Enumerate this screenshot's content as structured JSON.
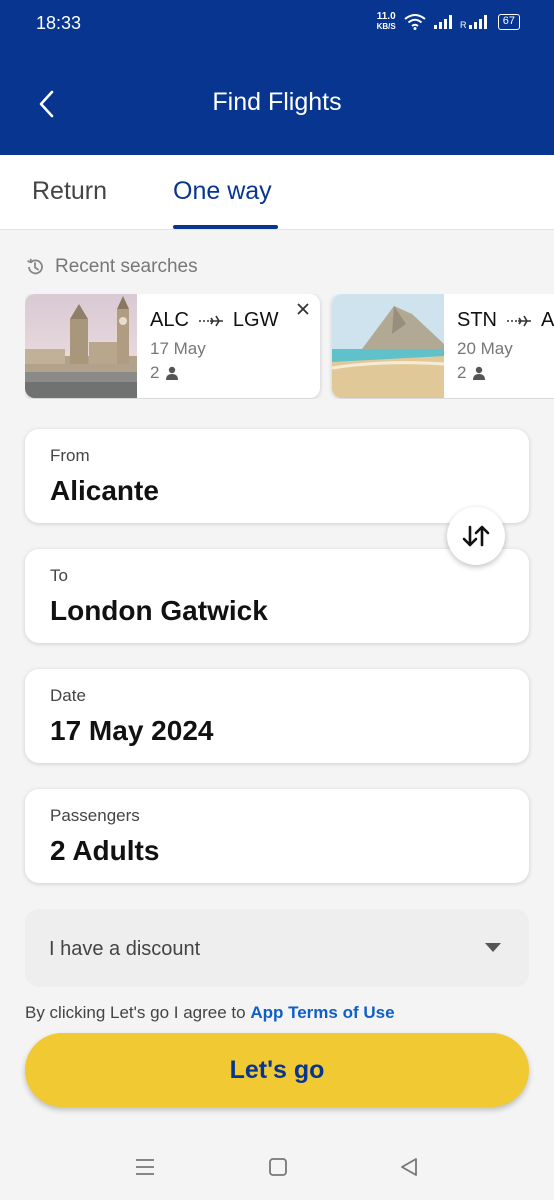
{
  "status_bar": {
    "time": "18:33",
    "net_speed_value": "11.0",
    "net_speed_unit": "KB/S",
    "battery": "67"
  },
  "header": {
    "title": "Find Flights"
  },
  "tabs": [
    {
      "label": "Return",
      "active": false
    },
    {
      "label": "One way",
      "active": true
    }
  ],
  "recent": {
    "label": "Recent searches",
    "cards": [
      {
        "from": "ALC",
        "to": "LGW",
        "date": "17 May",
        "passengers": "2"
      },
      {
        "from": "STN",
        "to": "A",
        "date": "20 May",
        "passengers": "2"
      }
    ]
  },
  "form": {
    "from": {
      "label": "From",
      "value": "Alicante"
    },
    "to": {
      "label": "To",
      "value": "London Gatwick"
    },
    "date": {
      "label": "Date",
      "value": "17 May 2024"
    },
    "passengers": {
      "label": "Passengers",
      "value": "2 Adults"
    },
    "discount_label": "I have a discount"
  },
  "terms": {
    "prefix": "By clicking Let's go I agree to ",
    "link": "App Terms of Use"
  },
  "cta": {
    "label": "Let's go"
  },
  "colors": {
    "brand_blue": "#073590",
    "accent_yellow": "#f1c933",
    "link_blue": "#0f5fc7"
  }
}
